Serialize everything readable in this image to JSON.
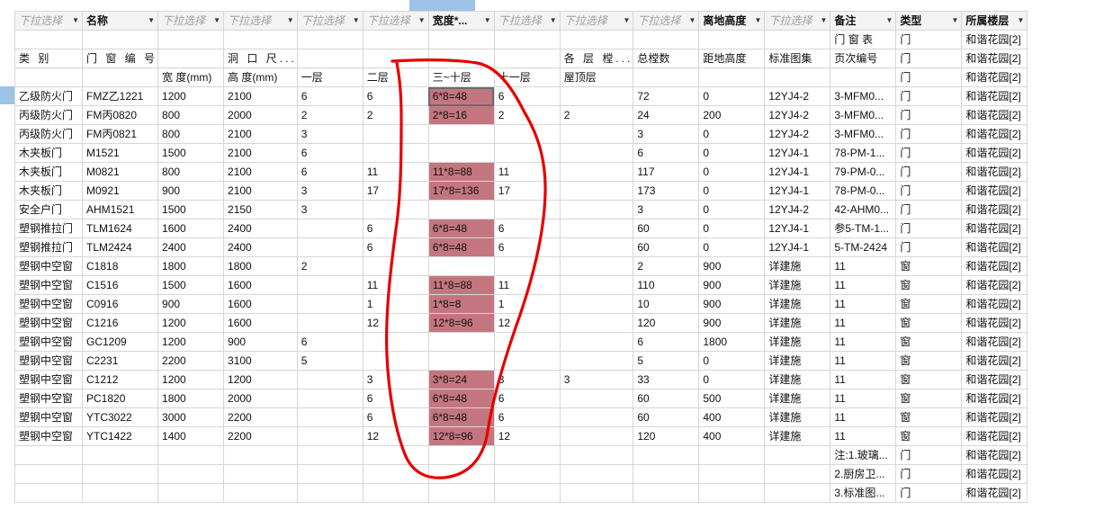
{
  "filter_header": [
    {
      "label": "下拉选择",
      "named": false
    },
    {
      "label": "名称",
      "named": true
    },
    {
      "label": "下拉选择",
      "named": false
    },
    {
      "label": "下拉选择",
      "named": false
    },
    {
      "label": "下拉选择",
      "named": false
    },
    {
      "label": "下拉选择",
      "named": false
    },
    {
      "label": "宽度*...",
      "named": true
    },
    {
      "label": "下拉选择",
      "named": false
    },
    {
      "label": "下拉选择",
      "named": false
    },
    {
      "label": "下拉选择",
      "named": false
    },
    {
      "label": "离地高度",
      "named": true
    },
    {
      "label": "下拉选择",
      "named": false
    },
    {
      "label": "备注",
      "named": true
    },
    {
      "label": "类型",
      "named": true
    },
    {
      "label": "所属楼层",
      "named": true
    }
  ],
  "rows": [
    [
      "",
      "",
      "",
      "",
      "",
      "",
      "",
      "",
      "",
      "",
      "",
      "",
      "门 窗 表",
      "门",
      "和谐花园[2]"
    ],
    [
      "类 别",
      "门 窗 编 号",
      "",
      "洞 口 尺...",
      "",
      "",
      "",
      "",
      "各 层 樘...",
      "总樘数",
      "距地高度",
      "标准图集",
      "页次编号",
      "门",
      "和谐花园[2]"
    ],
    [
      "",
      "",
      "宽 度(mm)",
      "高 度(mm)",
      "一层",
      "二层",
      "三~十层",
      "十一层",
      "屋顶层",
      "",
      "",
      "",
      "",
      "门",
      "和谐花园[2]"
    ],
    [
      "乙级防火门",
      "FMZ乙1221",
      "1200",
      "2100",
      "6",
      "6",
      "6*8=48",
      "6",
      "",
      "72",
      "0",
      "12YJ4-2",
      "3-MFM0...",
      "门",
      "和谐花园[2]"
    ],
    [
      "丙级防火门",
      "FM丙0820",
      "800",
      "2000",
      "2",
      "2",
      "2*8=16",
      "2",
      "2",
      "24",
      "200",
      "12YJ4-2",
      "3-MFM0...",
      "门",
      "和谐花园[2]"
    ],
    [
      "丙级防火门",
      "FM丙0821",
      "800",
      "2100",
      "3",
      "",
      "",
      "",
      "",
      "3",
      "0",
      "12YJ4-2",
      "3-MFM0...",
      "门",
      "和谐花园[2]"
    ],
    [
      "木夹板门",
      "M1521",
      "1500",
      "2100",
      "6",
      "",
      "",
      "",
      "",
      "6",
      "0",
      "12YJ4-1",
      "78-PM-1...",
      "门",
      "和谐花园[2]"
    ],
    [
      "木夹板门",
      "M0821",
      "800",
      "2100",
      "6",
      "11",
      "11*8=88",
      "11",
      "",
      "117",
      "0",
      "12YJ4-1",
      "79-PM-0...",
      "门",
      "和谐花园[2]"
    ],
    [
      "木夹板门",
      "M0921",
      "900",
      "2100",
      "3",
      "17",
      "17*8=136",
      "17",
      "",
      "173",
      "0",
      "12YJ4-1",
      "78-PM-0...",
      "门",
      "和谐花园[2]"
    ],
    [
      "安全户门",
      "AHM1521",
      "1500",
      "2150",
      "3",
      "",
      "",
      "",
      "",
      "3",
      "0",
      "12YJ4-2",
      "42-AHM0...",
      "门",
      "和谐花园[2]"
    ],
    [
      "塑钢推拉门",
      "TLM1624",
      "1600",
      "2400",
      "",
      "6",
      "6*8=48",
      "6",
      "",
      "60",
      "0",
      "12YJ4-1",
      "参5-TM-1...",
      "门",
      "和谐花园[2]"
    ],
    [
      "塑钢推拉门",
      "TLM2424",
      "2400",
      "2400",
      "",
      "6",
      "6*8=48",
      "6",
      "",
      "60",
      "0",
      "12YJ4-1",
      "5-TM-2424",
      "门",
      "和谐花园[2]"
    ],
    [
      "塑钢中空窗",
      "C1818",
      "1800",
      "1800",
      "2",
      "",
      "",
      "",
      "",
      "2",
      "900",
      "详建施",
      "11",
      "窗",
      "和谐花园[2]"
    ],
    [
      "塑钢中空窗",
      "C1516",
      "1500",
      "1600",
      "",
      "11",
      "11*8=88",
      "11",
      "",
      "110",
      "900",
      "详建施",
      "11",
      "窗",
      "和谐花园[2]"
    ],
    [
      "塑钢中空窗",
      "C0916",
      "900",
      "1600",
      "",
      "1",
      "1*8=8",
      "1",
      "",
      "10",
      "900",
      "详建施",
      "11",
      "窗",
      "和谐花园[2]"
    ],
    [
      "塑钢中空窗",
      "C1216",
      "1200",
      "1600",
      "",
      "12",
      "12*8=96",
      "12",
      "",
      "120",
      "900",
      "详建施",
      "11",
      "窗",
      "和谐花园[2]"
    ],
    [
      "塑钢中空窗",
      "GC1209",
      "1200",
      "900",
      "6",
      "",
      "",
      "",
      "",
      "6",
      "1800",
      "详建施",
      "11",
      "窗",
      "和谐花园[2]"
    ],
    [
      "塑钢中空窗",
      "C2231",
      "2200",
      "3100",
      "5",
      "",
      "",
      "",
      "",
      "5",
      "0",
      "详建施",
      "11",
      "窗",
      "和谐花园[2]"
    ],
    [
      "塑钢中空窗",
      "C1212",
      "1200",
      "1200",
      "",
      "3",
      "3*8=24",
      "3",
      "3",
      "33",
      "0",
      "详建施",
      "11",
      "窗",
      "和谐花园[2]"
    ],
    [
      "塑钢中空窗",
      "PC1820",
      "1800",
      "2000",
      "",
      "6",
      "6*8=48",
      "6",
      "",
      "60",
      "500",
      "详建施",
      "11",
      "窗",
      "和谐花园[2]"
    ],
    [
      "塑钢中空窗",
      "YTC3022",
      "3000",
      "2200",
      "",
      "6",
      "6*8=48",
      "6",
      "",
      "60",
      "400",
      "详建施",
      "11",
      "窗",
      "和谐花园[2]"
    ],
    [
      "塑钢中空窗",
      "YTC1422",
      "1400",
      "2200",
      "",
      "12",
      "12*8=96",
      "12",
      "",
      "120",
      "400",
      "详建施",
      "11",
      "窗",
      "和谐花园[2]"
    ],
    [
      "",
      "",
      "",
      "",
      "",
      "",
      "",
      "",
      "",
      "",
      "",
      "",
      "注:1.玻璃...",
      "门",
      "和谐花园[2]"
    ],
    [
      "",
      "",
      "",
      "",
      "",
      "",
      "",
      "",
      "",
      "",
      "",
      "",
      "2.厨房卫...",
      "门",
      "和谐花园[2]"
    ],
    [
      "",
      "",
      "",
      "",
      "",
      "",
      "",
      "",
      "",
      "",
      "",
      "",
      "3.标准图...",
      "门",
      "和谐花园[2]"
    ]
  ],
  "colors": {
    "highlight": "#c47680",
    "selection": "#9dc3e6",
    "ink": "#e60000"
  }
}
